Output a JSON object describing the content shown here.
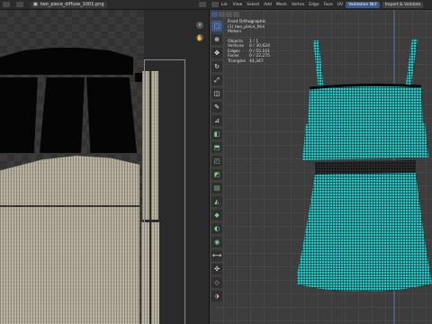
{
  "uv_header": {
    "image_name": "two_piece_diffuse_1001.png"
  },
  "viewport_header": {
    "mode": "Lin",
    "menus": [
      "View",
      "Select",
      "Add",
      "Mesh",
      "Vertex",
      "Edge",
      "Face",
      "UV"
    ],
    "buttons": [
      "Validation NLY",
      "Import & Validate"
    ]
  },
  "overlay": {
    "title": "Front Orthographic",
    "object": "(1) two_piece_thin",
    "units": "Meters",
    "stats": [
      {
        "label": "Objects",
        "value": "1 / 1"
      },
      {
        "label": "Vertices",
        "value": "0 / 30,624"
      },
      {
        "label": "Edges",
        "value": "0 / 55,101"
      },
      {
        "label": "Faces",
        "value": "0 / 22,275"
      },
      {
        "label": "Triangles",
        "value": "44,347"
      }
    ]
  },
  "uv_tools": [
    "magnifier-icon",
    "hand-icon"
  ],
  "viewport_tools": [
    "select",
    "cursor",
    "move",
    "rotate",
    "scale",
    "transform",
    "annotate",
    "measure",
    "add-cube",
    "extrude",
    "inset",
    "bevel",
    "loop-cut",
    "knife",
    "poly-build",
    "spin",
    "smooth",
    "edge-slide",
    "shrink-fatten",
    "shear",
    "rip"
  ],
  "colors": {
    "mesh": "#22c8c8",
    "wire": "#0a0a0a",
    "fabric": "#b4ad9c",
    "accent": "#3b5a8a"
  }
}
